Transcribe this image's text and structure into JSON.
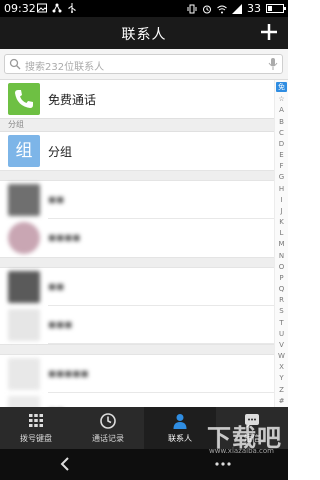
{
  "status_bar": {
    "time": "09:32",
    "battery": "33"
  },
  "header": {
    "title": "联系人",
    "add_label": "+"
  },
  "search": {
    "placeholder": "搜索232位联系人"
  },
  "list": {
    "free_call": "免费通话",
    "section_group": "分组",
    "group_avatar_char": "组",
    "group_label": "分组"
  },
  "index": {
    "badge": "免",
    "letters": [
      "☆",
      "A",
      "B",
      "C",
      "D",
      "E",
      "F",
      "G",
      "H",
      "I",
      "J",
      "K",
      "L",
      "M",
      "N",
      "O",
      "P",
      "Q",
      "R",
      "S",
      "T",
      "U",
      "V",
      "W",
      "X",
      "Y",
      "Z",
      "#"
    ]
  },
  "tabs": [
    {
      "label": "拨号键盘",
      "icon": "dialpad-icon"
    },
    {
      "label": "通话记录",
      "icon": "clock-icon"
    },
    {
      "label": "联系人",
      "icon": "person-icon"
    },
    {
      "label": "短信",
      "icon": "chat-bubble-icon"
    }
  ],
  "colors": {
    "accent": "#2f8de2",
    "green": "#6ec043"
  },
  "watermark": {
    "main": "下载吧",
    "sub": "www.xiazaiba.com"
  }
}
